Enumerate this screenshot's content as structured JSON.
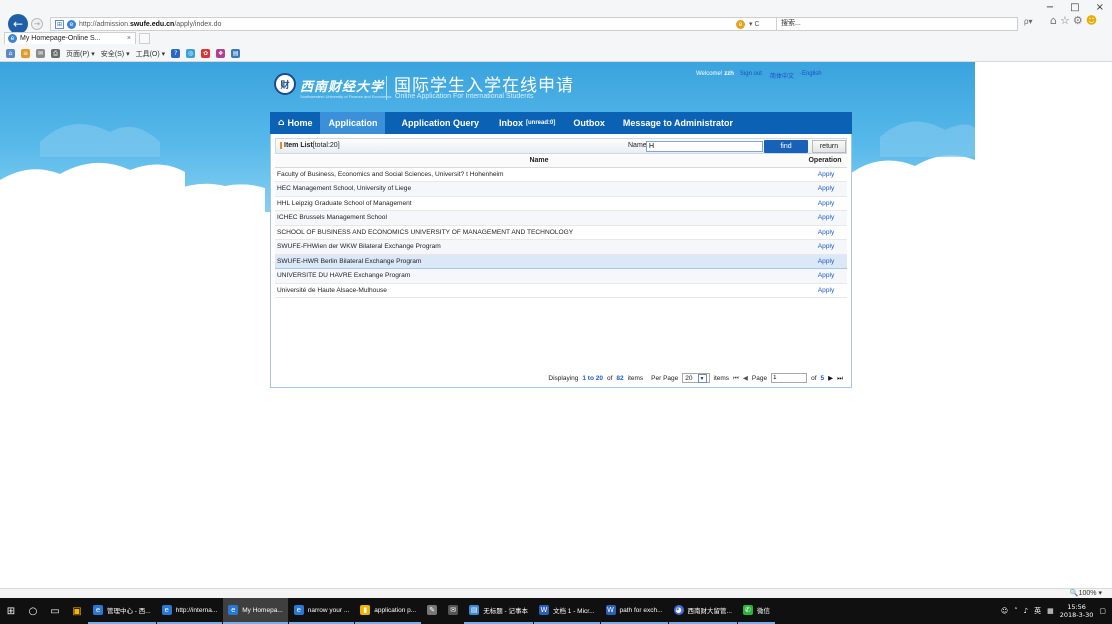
{
  "browser": {
    "url_prefix": "http://admission.",
    "url_domain": "swufe.edu.cn",
    "url_path": "/apply/index.do",
    "refresh_label": "▾ C",
    "search_placeholder": "搜索...",
    "search_go": "ρ▾",
    "tab_title": "My Homepage-Online S...",
    "tab_close": "×",
    "window_controls": [
      "−",
      "□",
      "×"
    ],
    "command_bar": [
      "页面(P) ▾",
      "安全(S) ▾",
      "工具(O) ▾"
    ],
    "zoom": "100%"
  },
  "header": {
    "logo_mark": "财",
    "logo_cn": "西南财经大学",
    "logo_en": "Southwestern University of Finance and Economics",
    "title_cn": "国际学生入学在线申请",
    "title_en": "Online Application For International Students",
    "welcome_label": "Welcome!",
    "username": "zzh",
    "sign_out": "Sign out",
    "lang_cn": "·简体中文",
    "lang_en": "·English"
  },
  "nav": {
    "home": "Home",
    "application": "Application",
    "query": "Application Query",
    "inbox": "Inbox",
    "inbox_unread": "[unread:0]",
    "outbox": "Outbox",
    "message_admin": "Message to Administrator"
  },
  "list": {
    "title": "Item List",
    "total": "[total:20]",
    "name_label": "Name",
    "search_value": "H",
    "find_label": "find",
    "return_label": "return",
    "col_name": "Name",
    "col_operation": "Operation",
    "apply_label": "Apply",
    "rows": [
      "Faculty of Business, Economics and Social Sciences, Universit? t Hohenheim",
      "HEC Management School, University of Liege",
      "HHL Leipzig Graduate School of Management",
      "ICHEC Brussels Management School",
      "SCHOOL OF BUSINESS AND ECONOMICS UNIVERSITY OF MANAGEMENT AND TECHNOLOGY",
      "SWUFE-FHWien der WKW Bilateral Exchange Program",
      "SWUFE-HWR Berlin Bilateral Exchange Program",
      "UNIVERSITE DU HAVRE Exchange Program",
      "Université de Haute Alsace-Mulhouse"
    ]
  },
  "pager": {
    "displaying": "Displaying",
    "range": "1 to 20",
    "of_label": "of",
    "total": "82",
    "items_label": "items",
    "per_page_label": "Per Page",
    "per_page_value": "20",
    "items_label2": "items",
    "page_label": "Page",
    "page_value": "1",
    "of_pages_label": "of",
    "pages": "5"
  },
  "taskbar": {
    "apps": [
      "管理中心 - 西...",
      "http://interna...",
      "My Homepa...",
      "narrow your ...",
      "application p...",
      "",
      "",
      "无标题 - 记事本",
      "文档 1 - Micr...",
      "path for exch...",
      "西南财大留管...",
      "微信"
    ],
    "tray_lang": "英",
    "time": "15:56",
    "date": "2018-3-30"
  },
  "colors": {
    "nav_bg": "#0b62b5",
    "nav_active": "#3c8fd9",
    "find_btn": "#1762b8",
    "link": "#1a5cc8"
  }
}
